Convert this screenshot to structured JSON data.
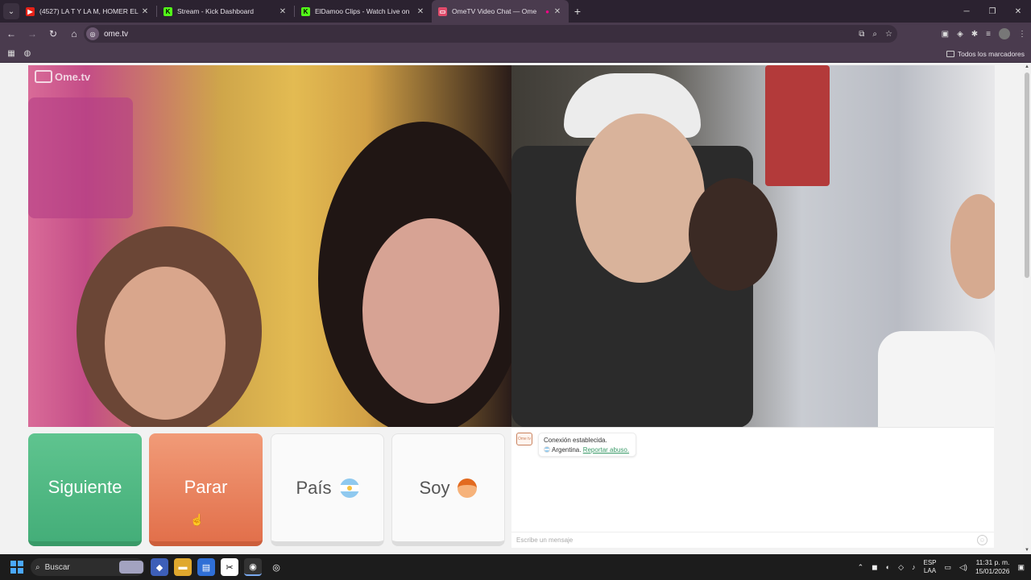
{
  "browser": {
    "tabs": [
      {
        "title": "(4527) LA T Y LA M, HOMER EL",
        "favicon_color": "#e62117",
        "active": false
      },
      {
        "title": "Stream - Kick Dashboard",
        "favicon_color": "#53fc18",
        "active": false
      },
      {
        "title": "ElDamoo Clips - Watch Live on",
        "favicon_color": "#53fc18",
        "active": false
      },
      {
        "title": "OmeTV Video Chat — Ome",
        "favicon_color": "#e04b6b",
        "active": true
      }
    ],
    "url": "ome.tv",
    "bookmarks_all": "Todos los marcadores"
  },
  "page": {
    "logo_text": "Ome.tv",
    "buttons": {
      "next": "Siguiente",
      "stop": "Parar",
      "country": "País",
      "gender": "Soy"
    },
    "chat": {
      "avatar_text": "Ome tv",
      "status": "Conexión establecida.",
      "country": "Argentina.",
      "report": "Reportar abuso.",
      "input_placeholder": "Escribe un mensaje"
    }
  },
  "taskbar": {
    "search": "Buscar",
    "lang_top": "ESP",
    "lang_bottom": "LAA",
    "time": "11:31 p. m.",
    "date": "15/01/2026"
  },
  "colors": {
    "next_green": "#5fc48f",
    "stop_orange": "#e2704b",
    "report_link": "#3a9a68"
  }
}
